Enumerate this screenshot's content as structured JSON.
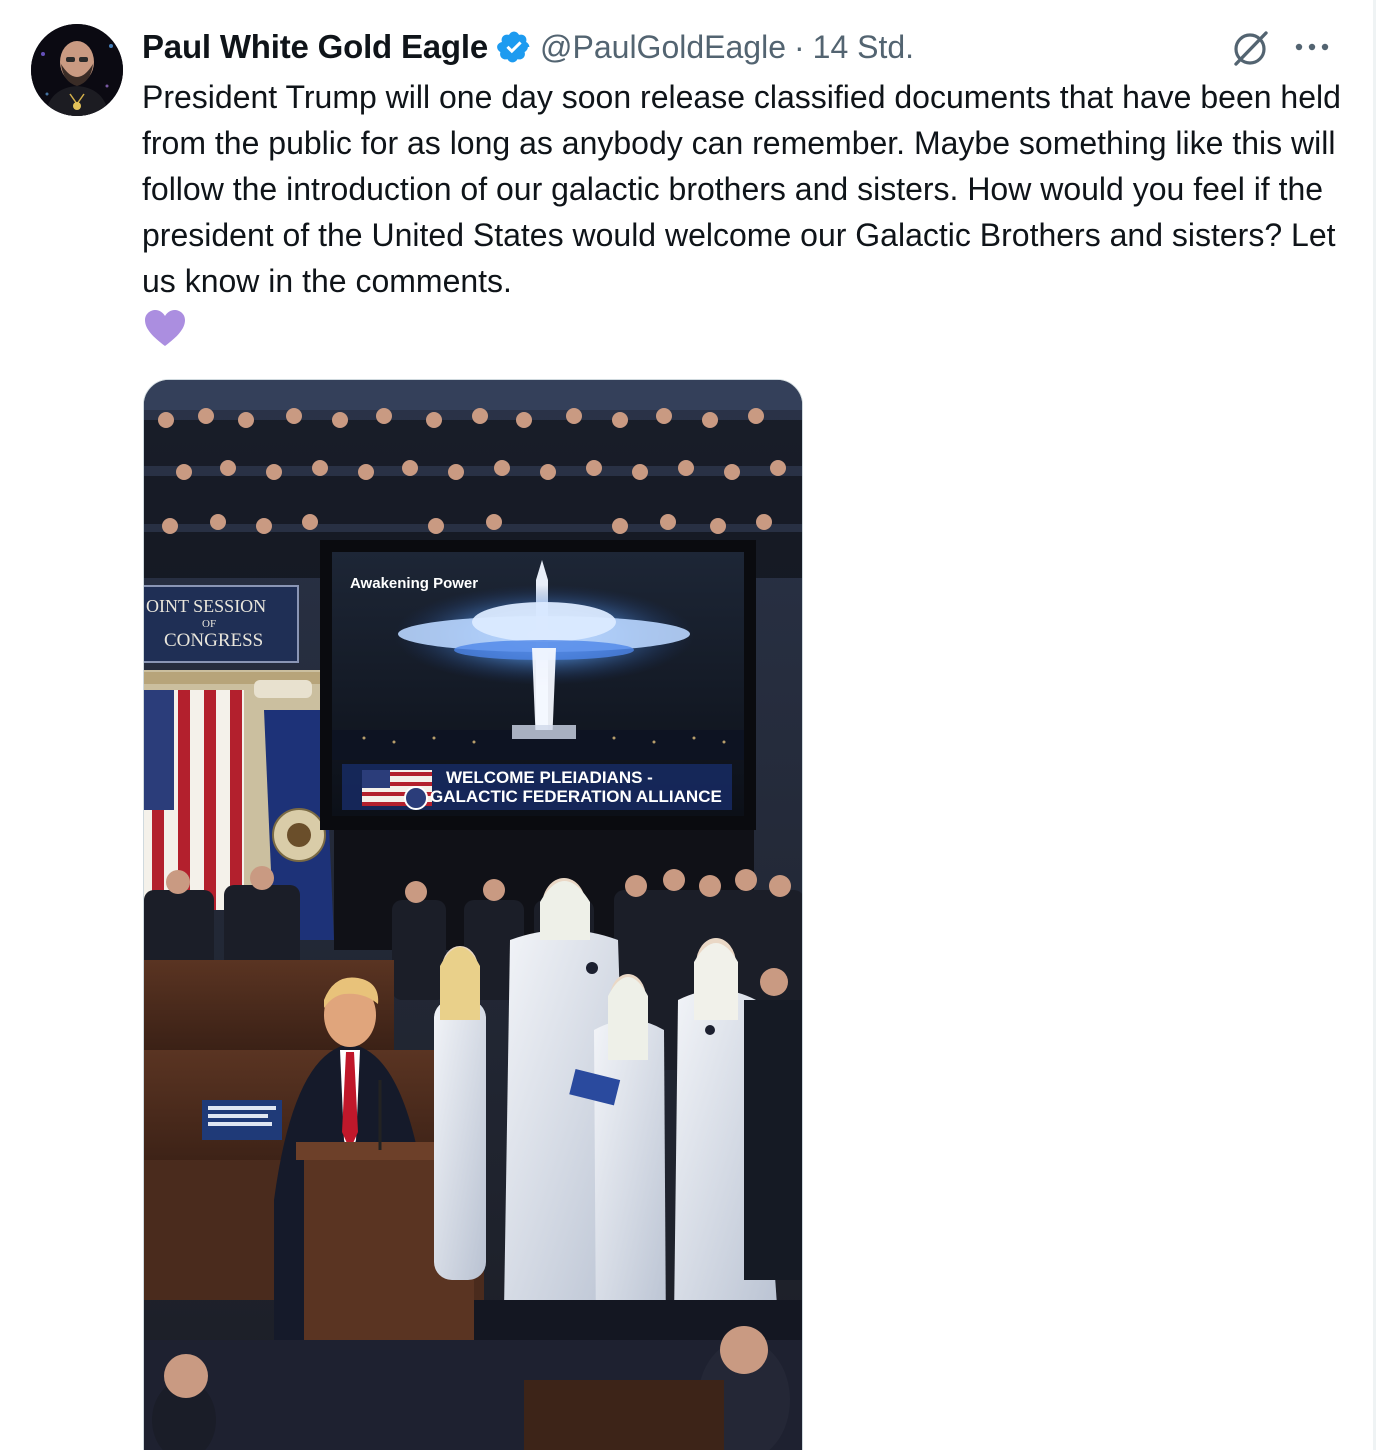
{
  "tweet": {
    "author": {
      "display_name": "Paul White Gold Eagle",
      "verified": true,
      "handle": "@PaulGoldEagle",
      "separator": "·",
      "time": "14 Std."
    },
    "text": "President Trump will one day soon release classified documents that have been held from the public for as long as anybody can remember. Maybe something like this will follow the introduction of our galactic brothers and sisters. How would you feel if the president of the United States would welcome our Galactic Brothers and sisters? Let us know in the comments.",
    "emoji": "purple-heart",
    "icons": {
      "verified": "verified-badge-icon",
      "grok": "grok-icon",
      "more": "more-options-icon"
    },
    "colors": {
      "verified_blue": "#1d9bf0",
      "heart_purple": "#ab8ee0",
      "secondary_text": "#536471"
    },
    "media": {
      "screen_caption": "Awakening Power",
      "banner_line1": "WELCOME PLEIADIANS -",
      "banner_line2": "GALACTIC FEDERATION ALLIANCE",
      "session_sign_line1": "OINT SESSION",
      "session_sign_line2": "OF",
      "session_sign_line3": "CONGRESS"
    }
  }
}
